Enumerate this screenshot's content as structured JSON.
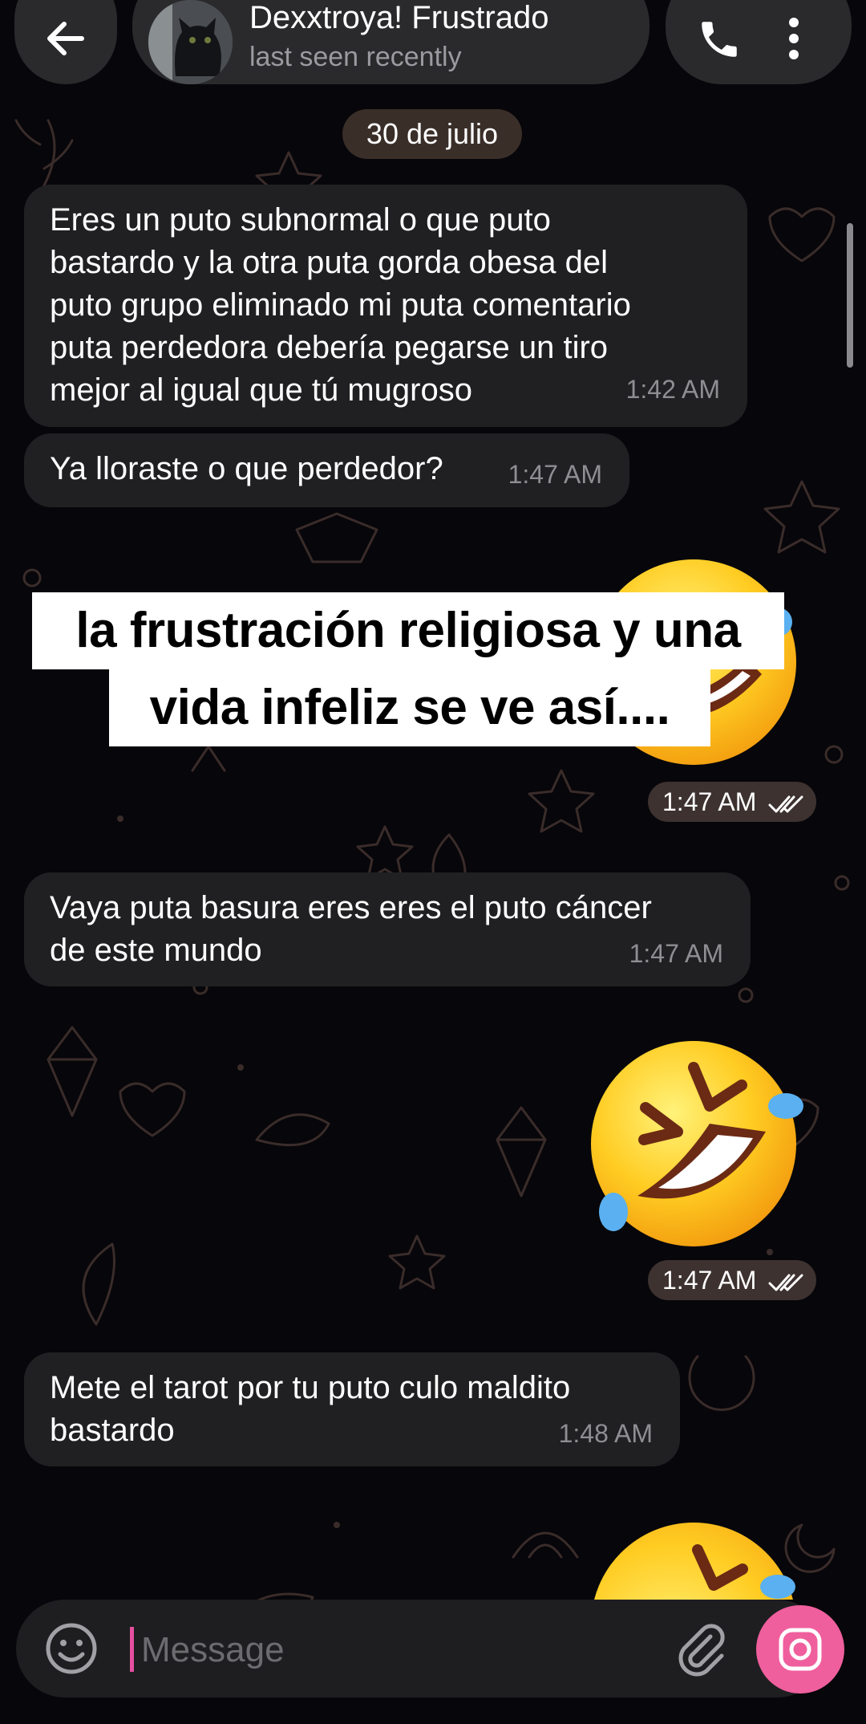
{
  "header": {
    "back_icon": "arrow-left-icon",
    "title": "Dexxtroya! Frustrado",
    "status": "last seen recently",
    "call_icon": "phone-icon",
    "menu_icon": "more-vertical-icon"
  },
  "date_chip": "30 de julio",
  "messages": [
    {
      "direction": "incoming",
      "lines": [
        "Eres un puto subnormal o que puto",
        "bastardo y la otra puta gorda obesa del",
        "puto grupo eliminado mi puta comentario",
        "puta perdedora debería pegarse un tiro",
        "mejor al igual que tú mugroso"
      ],
      "time": "1:42 AM"
    },
    {
      "direction": "incoming",
      "lines": [
        "Ya lloraste o que perdedor?"
      ],
      "time": "1:47 AM"
    },
    {
      "direction": "outgoing",
      "emoji": "rolling-on-floor-laughing-emoji",
      "time": "1:47 AM",
      "status_icon": "double-check-icon"
    },
    {
      "direction": "incoming",
      "lines": [
        "Vaya puta basura eres eres el puto cáncer",
        "de este mundo"
      ],
      "time": "1:47 AM"
    },
    {
      "direction": "outgoing",
      "emoji": "rolling-on-floor-laughing-emoji",
      "time": "1:47 AM",
      "status_icon": "double-check-icon"
    },
    {
      "direction": "incoming",
      "lines": [
        "Mete el tarot por tu puto culo maldito",
        "bastardo"
      ],
      "time": "1:48 AM"
    },
    {
      "direction": "outgoing",
      "emoji": "rolling-on-floor-laughing-emoji"
    }
  ],
  "overlay_caption": {
    "line1": "la frustración religiosa y una",
    "line2": "vida infeliz se ve así...."
  },
  "composer": {
    "emoji_icon": "smiley-icon",
    "placeholder": "Message",
    "attach_icon": "paperclip-icon",
    "camera_icon": "camera-icon",
    "accent_color": "#ef5f9d"
  }
}
